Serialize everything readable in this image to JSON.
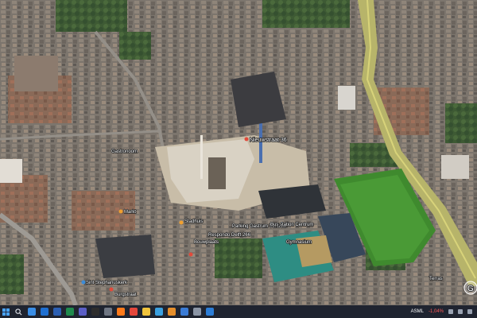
{
  "map": {
    "labels": {
      "nieuwstraat": "Nieuwstraat 36",
      "parking": "Parking Gastrum Schouw",
      "stadhuis": "Stadhuis",
      "bus": "Bus station Centrum",
      "gym": "Gymnasium",
      "stephanus": "Sint Stephanuskerk",
      "markt": "Markt",
      "sportstraat": "Burgstraat",
      "terras": "Terras",
      "kelder": "Gastronoom",
      "bouw": "Bouwplaats",
      "delft": "Respondo Delft 266"
    },
    "compass_letter": "G"
  },
  "taskbar": {
    "apps": [
      {
        "name": "edge",
        "color": "#3a8ee6"
      },
      {
        "name": "outlook",
        "color": "#1e6fd1"
      },
      {
        "name": "word",
        "color": "#2b5fb3"
      },
      {
        "name": "excel",
        "color": "#1f8a4d"
      },
      {
        "name": "teams",
        "color": "#5b5fc7"
      },
      {
        "name": "terminal",
        "color": "#2d2d2d"
      },
      {
        "name": "settings",
        "color": "#6f7683"
      },
      {
        "name": "firefox",
        "color": "#ff7a1a"
      },
      {
        "name": "chrome",
        "color": "#e4473b"
      },
      {
        "name": "files",
        "color": "#f0c33c"
      },
      {
        "name": "store",
        "color": "#3aa0e0"
      },
      {
        "name": "photos",
        "color": "#e58e2a"
      },
      {
        "name": "mail",
        "color": "#3a7bd5"
      },
      {
        "name": "calc",
        "color": "#8b95a5"
      },
      {
        "name": "earth",
        "color": "#2c7dd6"
      }
    ],
    "ticker_name": "ASML",
    "ticker_change": "-1,04%"
  }
}
